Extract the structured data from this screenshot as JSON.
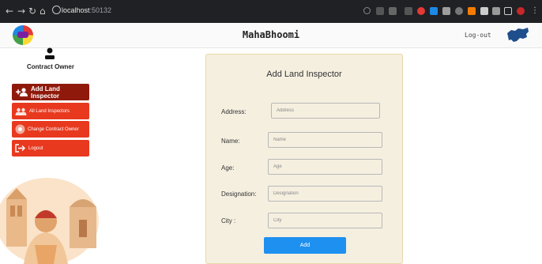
{
  "browser": {
    "url_host": "localhost",
    "url_port": ":50132",
    "nav_icons": [
      "back-arrow-icon",
      "forward-arrow-icon",
      "reload-icon",
      "home-icon",
      "info-icon"
    ]
  },
  "header": {
    "brand": "MahaBhoomi",
    "logout_label": "Log-out"
  },
  "user": {
    "role": "Contract Owner"
  },
  "sidebar": {
    "items": [
      {
        "label": "Add Land Inspector",
        "icon": "add-user-icon",
        "active": true
      },
      {
        "label": "All Land Inspectors",
        "icon": "users-icon",
        "active": false
      },
      {
        "label": "Change Contract Owner",
        "icon": "change-owner-icon",
        "active": false
      },
      {
        "label": "Logout",
        "icon": "logout-icon",
        "active": false
      }
    ]
  },
  "form": {
    "title": "Add Land Inspector",
    "fields": [
      {
        "label": "Address:",
        "placeholder": "Address"
      },
      {
        "label": "Name:",
        "placeholder": "Name"
      },
      {
        "label": "Age:",
        "placeholder": "Age"
      },
      {
        "label": "Designation:",
        "placeholder": "Designation"
      },
      {
        "label": "City :",
        "placeholder": "City"
      }
    ],
    "submit_label": "Add"
  },
  "colors": {
    "sidebar_button": "#e8391f",
    "sidebar_active": "#8f1a0c",
    "card_background": "#f5efe0",
    "add_button": "#1e90f0"
  }
}
